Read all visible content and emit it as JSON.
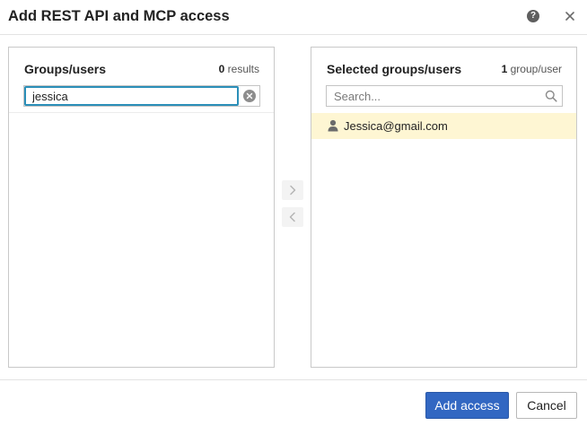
{
  "dialog": {
    "title": "Add REST API and MCP access",
    "help_icon": "help-icon",
    "help_glyph": "?",
    "close_icon": "close-icon"
  },
  "left_panel": {
    "title": "Groups/users",
    "count_value": "0",
    "count_unit": " results",
    "search": {
      "value": "jessica",
      "clear_icon": "clear-icon"
    },
    "items": []
  },
  "right_panel": {
    "title": "Selected groups/users",
    "count_value": "1",
    "count_unit": " group/user",
    "search": {
      "placeholder": "Search...",
      "icon": "search-icon"
    },
    "items": [
      {
        "label": "Jessica@gmail.com",
        "icon": "user-icon",
        "highlighted": true
      }
    ]
  },
  "transfer": {
    "add_icon": "chevron-right-icon",
    "remove_icon": "chevron-left-icon"
  },
  "footer": {
    "primary_label": "Add access",
    "secondary_label": "Cancel"
  },
  "colors": {
    "primary": "#3267c2",
    "focus": "#2b8fb8",
    "selected_row": "#fef6d3"
  }
}
